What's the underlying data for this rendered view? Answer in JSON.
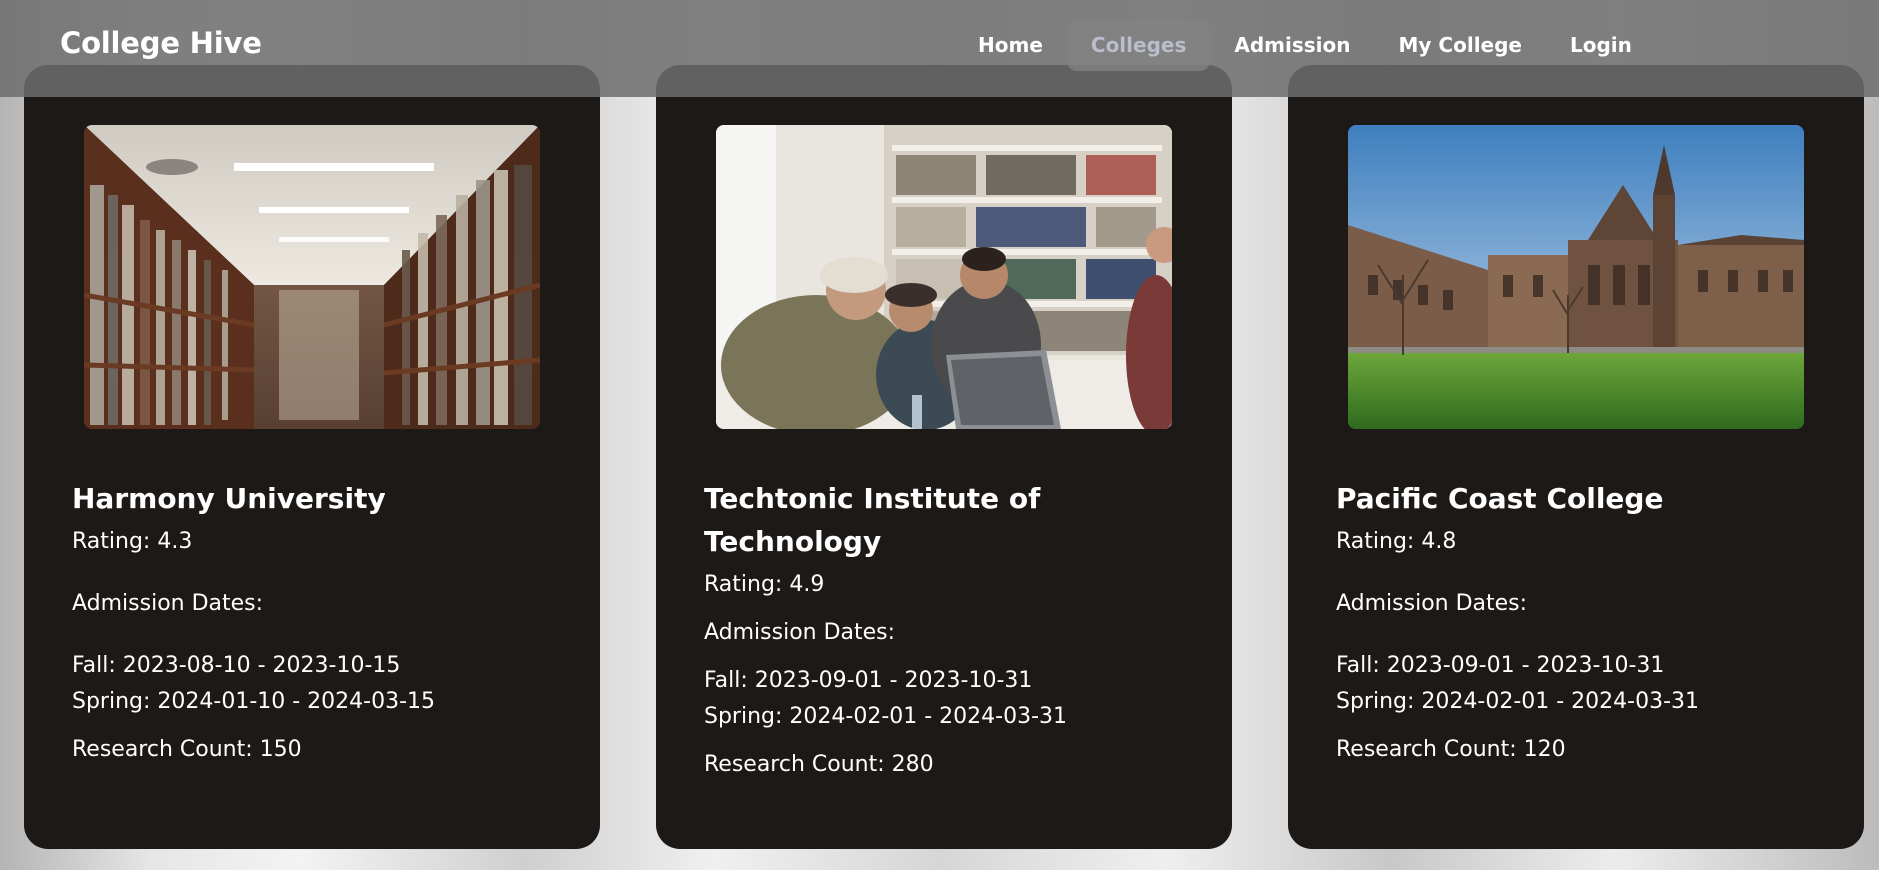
{
  "app": {
    "brand": "College Hive"
  },
  "nav": {
    "items": [
      {
        "label": "Home",
        "active": false
      },
      {
        "label": "Colleges",
        "active": true
      },
      {
        "label": "Admission",
        "active": false
      },
      {
        "label": "My College",
        "active": false
      },
      {
        "label": "Login",
        "active": false
      }
    ]
  },
  "colors": {
    "card_bg": "#1c1917",
    "nav_bg": "#6e6e6e",
    "active_link": "#b9bdcc",
    "text": "#ffffff"
  },
  "colleges": [
    {
      "name": "Harmony University",
      "rating": "Rating: 4.3",
      "admission_heading": "Admission Dates:",
      "fall": "Fall: 2023-08-10 - 2023-10-15",
      "spring": "Spring: 2024-01-10 - 2024-03-15",
      "research": "Research Count: 150",
      "image": "library-aisle-photo"
    },
    {
      "name": "Techtonic Institute of Technology",
      "rating": "Rating: 4.9",
      "admission_heading": "Admission Dates:",
      "fall": "Fall: 2023-09-01 - 2023-10-31",
      "spring": "Spring: 2024-02-01 - 2024-03-31",
      "research": "Research Count: 280",
      "image": "students-laptop-photo"
    },
    {
      "name": "Pacific Coast College",
      "rating": "Rating: 4.8",
      "admission_heading": "Admission Dates:",
      "fall": "Fall: 2023-09-01 - 2023-10-31",
      "spring": "Spring: 2024-02-01 - 2024-03-31",
      "research": "Research Count: 120",
      "image": "campus-building-photo"
    }
  ]
}
